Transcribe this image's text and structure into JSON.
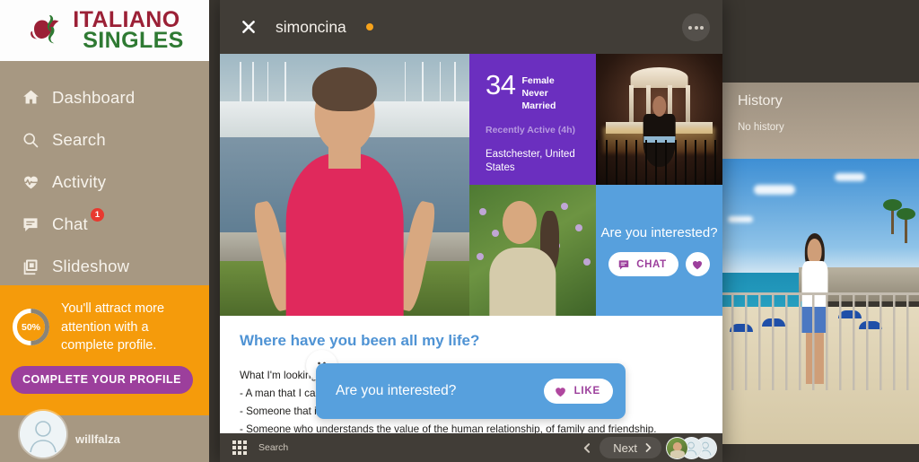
{
  "brand": {
    "line1": "ITALIANO",
    "line2": "SINGLES",
    "logo_icon": "heart-ribbon-logo",
    "color_primary": "#9b2036",
    "color_secondary": "#2f7a33"
  },
  "sidebar": {
    "items": [
      {
        "label": "Dashboard",
        "icon": "home-icon",
        "badge": ""
      },
      {
        "label": "Search",
        "icon": "search-icon",
        "badge": ""
      },
      {
        "label": "Activity",
        "icon": "heartbeat-icon",
        "badge": ""
      },
      {
        "label": "Chat",
        "icon": "chat-bubble-icon",
        "badge": "1"
      },
      {
        "label": "Slideshow",
        "icon": "slideshow-icon",
        "badge": ""
      }
    ],
    "promo": {
      "percent_label": "50%",
      "percent_value": 50,
      "message": "You'll attract more attention with a complete profile.",
      "button": "COMPLETE YOUR PROFILE",
      "accent": "#f59b0b",
      "button_color": "#9c3f9c"
    },
    "user": {
      "name": "willfalza",
      "avatar_icon": "default-user-avatar"
    }
  },
  "topbar": {
    "close_icon": "close-x-icon",
    "profile_name": "simoncina",
    "status_dot_color": "#f7a31b",
    "more_icon": "more-options-icon"
  },
  "profile": {
    "age": "34",
    "gender": "Female",
    "marital_status": "Never Married",
    "activity": "Recently Active (4h)",
    "location": "Eastchester, United States",
    "info_bg": "#6b2fbf",
    "photos": [
      {
        "name": "main-photo",
        "alt": "Woman in pink tank top at marina"
      },
      {
        "name": "photo-gazebo",
        "alt": "Woman by illuminated gazebo fountain at night"
      },
      {
        "name": "photo-garden",
        "alt": "Woman smiling in front of flowering garden"
      }
    ]
  },
  "cta_tile": {
    "title": "Are you interested?",
    "chat_label": "CHAT",
    "chat_icon": "chat-bubble-icon",
    "like_icon": "heart-icon",
    "bg": "#57a0dd"
  },
  "bio": {
    "headline": "Where have you been all my life?",
    "lines": [
      "What I'm looking for:",
      "- A man that I can feel safe and secure with.",
      "- Someone that is attentive, caring and strong enough to maintain it.",
      "- Someone who understands the value of the human relationship, of family and friendship."
    ]
  },
  "interest_overlay": {
    "smiley_icon": "smiley-face-icon",
    "text": "Are you interested?",
    "like_label": "LIKE",
    "like_icon": "heart-icon",
    "bg": "#57a0dd"
  },
  "history_panel": {
    "title": "History",
    "empty_text": "No history"
  },
  "background_photo": {
    "name": "beach-photo",
    "alt": "Woman at beach railing with blue umbrellas"
  },
  "bottombar": {
    "grid_icon": "grid-view-icon",
    "search_label": "Search",
    "back_icon": "chevron-left-icon",
    "next_label": "Next",
    "next_icon": "chevron-right-icon",
    "avatars": [
      "avatar-photo",
      "avatar-placeholder",
      "avatar-placeholder"
    ]
  }
}
